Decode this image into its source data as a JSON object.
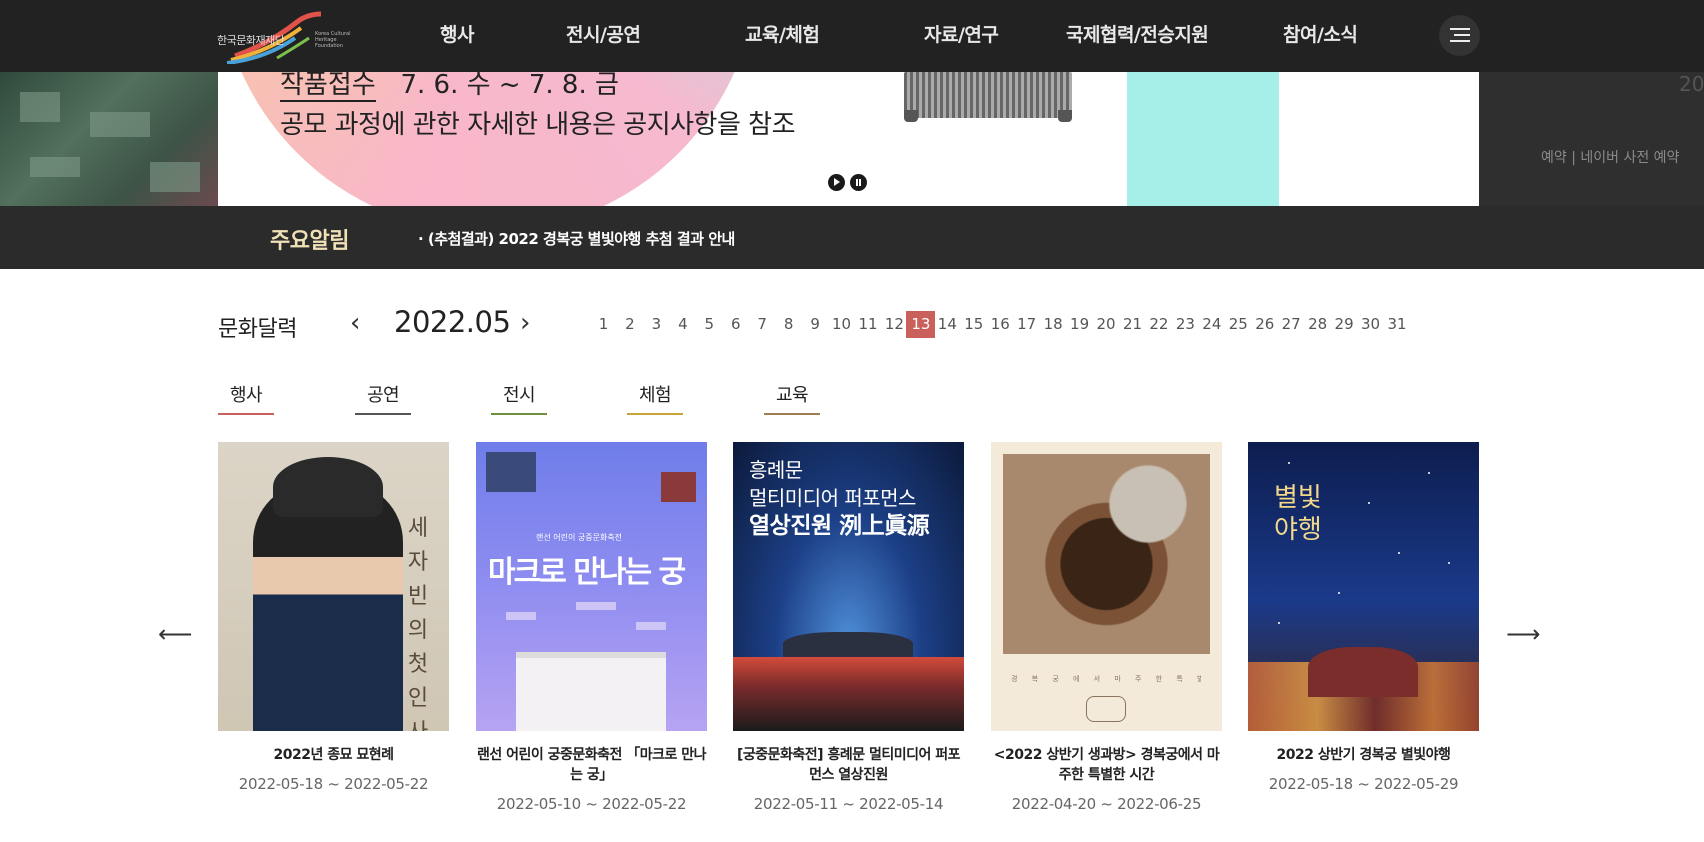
{
  "header": {
    "logo_ko": "한국문화재재단",
    "logo_en": "Korea Cultural Heritage Foundation",
    "nav": [
      "행사",
      "전시/공연",
      "교육/체험",
      "자료/연구",
      "국제협력/전승지원",
      "참여/소식"
    ],
    "menu_icon": "hamburger-icon"
  },
  "hero": {
    "line1_label": "작품접수",
    "line1_date": "7. 6. 수 ~ 7. 8. 금",
    "line2": "공모 과정에 관한 자세한 내용은 공지사항을 참조",
    "right_fragment": "20",
    "right_booking": "예약 | 네이버 사전 예약",
    "controls": [
      "play-icon",
      "pause-icon"
    ]
  },
  "notice": {
    "title": "주요알림",
    "text": "· (추첨결과) 2022 경복궁 별빛야행 추첨 결과 안내"
  },
  "calendar": {
    "title": "문화달력",
    "month": "2022.05",
    "days": [
      "1",
      "2",
      "3",
      "4",
      "5",
      "6",
      "7",
      "8",
      "9",
      "10",
      "11",
      "12",
      "13",
      "14",
      "15",
      "16",
      "17",
      "18",
      "19",
      "20",
      "21",
      "22",
      "23",
      "24",
      "25",
      "26",
      "27",
      "28",
      "29",
      "30",
      "31"
    ],
    "selected_day": "13",
    "selected_color": "#c9605b"
  },
  "categories": [
    {
      "label": "행사",
      "color": "#c9605b"
    },
    {
      "label": "공연",
      "color": "#555555"
    },
    {
      "label": "전시",
      "color": "#6e8f3a"
    },
    {
      "label": "체험",
      "color": "#c9a43a"
    },
    {
      "label": "교육",
      "color": "#a07c52"
    }
  ],
  "cards": [
    {
      "title": "2022년 종묘 묘현례",
      "date": "2022-05-18 ~ 2022-05-22",
      "poster_text": "세자빈의 첫 인사"
    },
    {
      "title": "랜선 어린이 궁중문화축전 「마크로 만나는 궁」",
      "date": "2022-05-10 ~ 2022-05-22",
      "poster_text": "마크로 만나는 궁",
      "poster_sub": "랜선 어린이 궁중문화축전"
    },
    {
      "title": "[궁중문화축전] 흥례문 멀티미디어 퍼포먼스 열상진원",
      "date": "2022-05-11 ~ 2022-05-14",
      "poster_line1": "흥례문",
      "poster_line2": "멀티미디어 퍼포먼스",
      "poster_line3": "열상진원 洌上眞源"
    },
    {
      "title": "<2022 상반기 생과방> 경복궁에서 마주한 특별한 시간",
      "date": "2022-04-20 ~ 2022-06-25",
      "poster_text": "경 복 궁 에 서   마 주 한   특 별 한   시 간"
    },
    {
      "title": "2022 상반기 경복궁 별빛야행",
      "date": "2022-05-18 ~ 2022-05-29",
      "poster_text": "별빛 야행"
    }
  ],
  "carousel": {
    "prev_icon": "arrow-left-icon",
    "next_icon": "arrow-right-icon"
  }
}
